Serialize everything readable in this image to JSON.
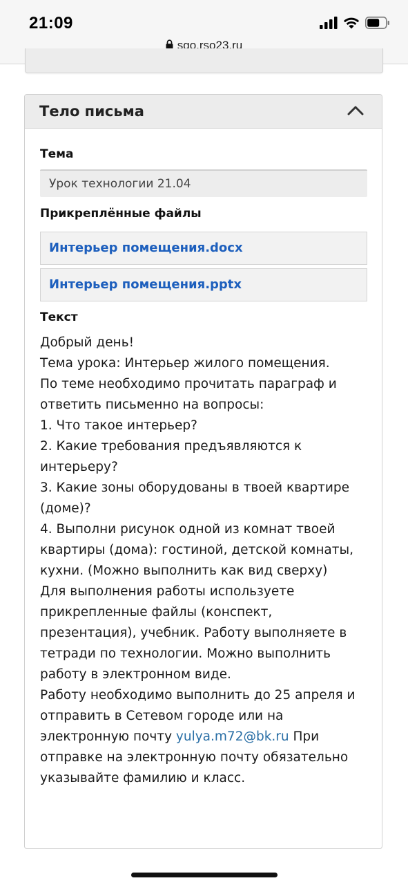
{
  "status_bar": {
    "time": "21:09",
    "url": "sgo.rso23.ru"
  },
  "card": {
    "title": "Тело письма",
    "subject_label": "Тема",
    "subject_value": "Урок технологии 21.04",
    "attachments_label": "Прикреплённые файлы",
    "attachments": [
      "Интерьер помещения.docx",
      "Интерьер помещения.pptx"
    ],
    "text_label": "Текст",
    "text": {
      "l1": "Добрый день!",
      "l2": "Тема урока: Интерьер жилого помещения.",
      "l3": "По теме необходимо прочитать параграф и",
      "l4": "ответить письменно на вопросы:",
      "l5": "1. Что такое интерьер?",
      "l6": "2. Какие требования предъявляются к",
      "l7": "интерьеру?",
      "l8": "3. Какие зоны оборудованы в твоей квартире",
      "l9": "(доме)?",
      "l10": "4. Выполни рисунок одной из комнат твоей",
      "l11": "квартиры (дома): гостиной, детской комнаты,",
      "l12": "кухни. (Можно выполнить как вид сверху)",
      "l13": "Для выполнения работы используете",
      "l14": "прикрепленные файлы (конспект,",
      "l15": "презентация), учебник.  Работу выполняете в",
      "l16": "тетради по технологии. Можно выполнить",
      "l17": "работу в электронном виде.",
      "l18": "Работу необходимо выполнить до 25 апреля и",
      "l19": "отправить в Сетевом городе или  на",
      "l20_prefix": "электронную почту ",
      "email": "yulya.m72@bk.ru",
      "l20_suffix": "  При",
      "l21": "отправке на электронную почту обязательно",
      "l22": "указывайте фамилию и класс."
    }
  },
  "colors": {
    "link": "#1d5fbd",
    "email_link": "#2a6fa6",
    "header_bg": "#ececec"
  },
  "icons": {
    "lock": "lock-icon",
    "signal": "signal-icon",
    "wifi": "wifi-icon",
    "battery": "battery-icon",
    "chevron": "chevron-up-icon"
  }
}
